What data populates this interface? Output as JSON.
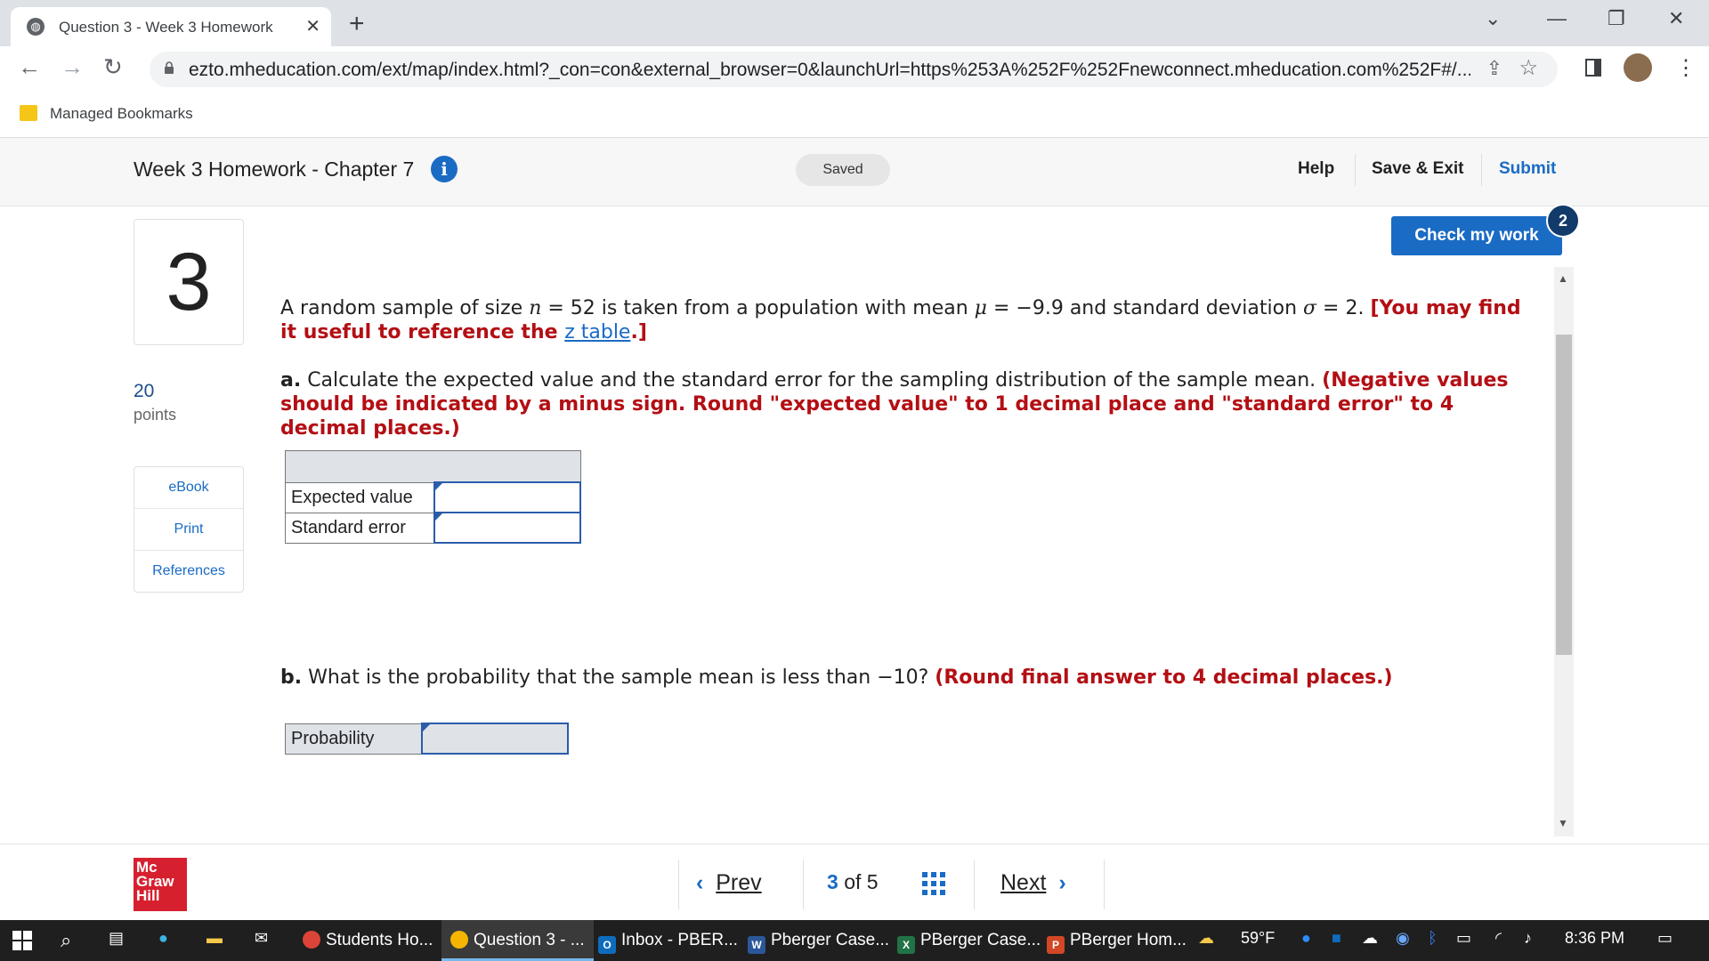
{
  "browser": {
    "tab_title": "Question 3 - Week 3 Homework",
    "url": "ezto.mheducation.com/ext/map/index.html?_con=con&external_browser=0&launchUrl=https%253A%252F%252Fnewconnect.mheducation.com%252F#/...",
    "bookmarks_label": "Managed Bookmarks"
  },
  "header": {
    "assignment_title": "Week 3 Homework - Chapter 7",
    "save_status": "Saved",
    "help": "Help",
    "save_exit": "Save & Exit",
    "submit": "Submit"
  },
  "question": {
    "number": "3",
    "points_value": "20",
    "points_label": "points",
    "tools": [
      "eBook",
      "Print",
      "References"
    ],
    "check_my_work": "Check my work",
    "check_badge": "2",
    "intro": {
      "pre": "A random sample of size ",
      "n_sym": "n",
      "n_val": " = 52 is taken from a population with mean ",
      "mu_sym": "μ",
      "mu_val": " = −9.9 and standard deviation ",
      "sigma_sym": "σ",
      "sigma_val": " = 2. ",
      "hint_a": "[You may find it useful to reference the ",
      "hint_link": "z table",
      "hint_b": ".]"
    },
    "part_a": {
      "label": "a.",
      "text": " Calculate the expected value and the standard error for the sampling distribution of the sample mean. ",
      "instruction": "(Negative values should be indicated by a minus sign. Round \"expected value\" to 1 decimal place and \"standard error\" to 4 decimal places.)",
      "rows": [
        {
          "label": "Expected value",
          "value": ""
        },
        {
          "label": "Standard error",
          "value": ""
        }
      ]
    },
    "part_b": {
      "label": "b.",
      "text": " What is the probability that the sample mean is less than −10? ",
      "instruction": "(Round final answer to 4 decimal places.)",
      "row": {
        "label": "Probability",
        "value": ""
      }
    }
  },
  "footer": {
    "logo_lines": [
      "Mc",
      "Graw",
      "Hill"
    ],
    "prev": "Prev",
    "current": "3",
    "of": "of",
    "total": "5",
    "next": "Next"
  },
  "taskbar": {
    "tasks": [
      "Students Ho...",
      "Question 3 - ...",
      "Inbox - PBER...",
      "Pberger Case...",
      "PBerger Case...",
      "PBerger Hom..."
    ],
    "weather": "59°F",
    "time": "8:36 PM"
  }
}
